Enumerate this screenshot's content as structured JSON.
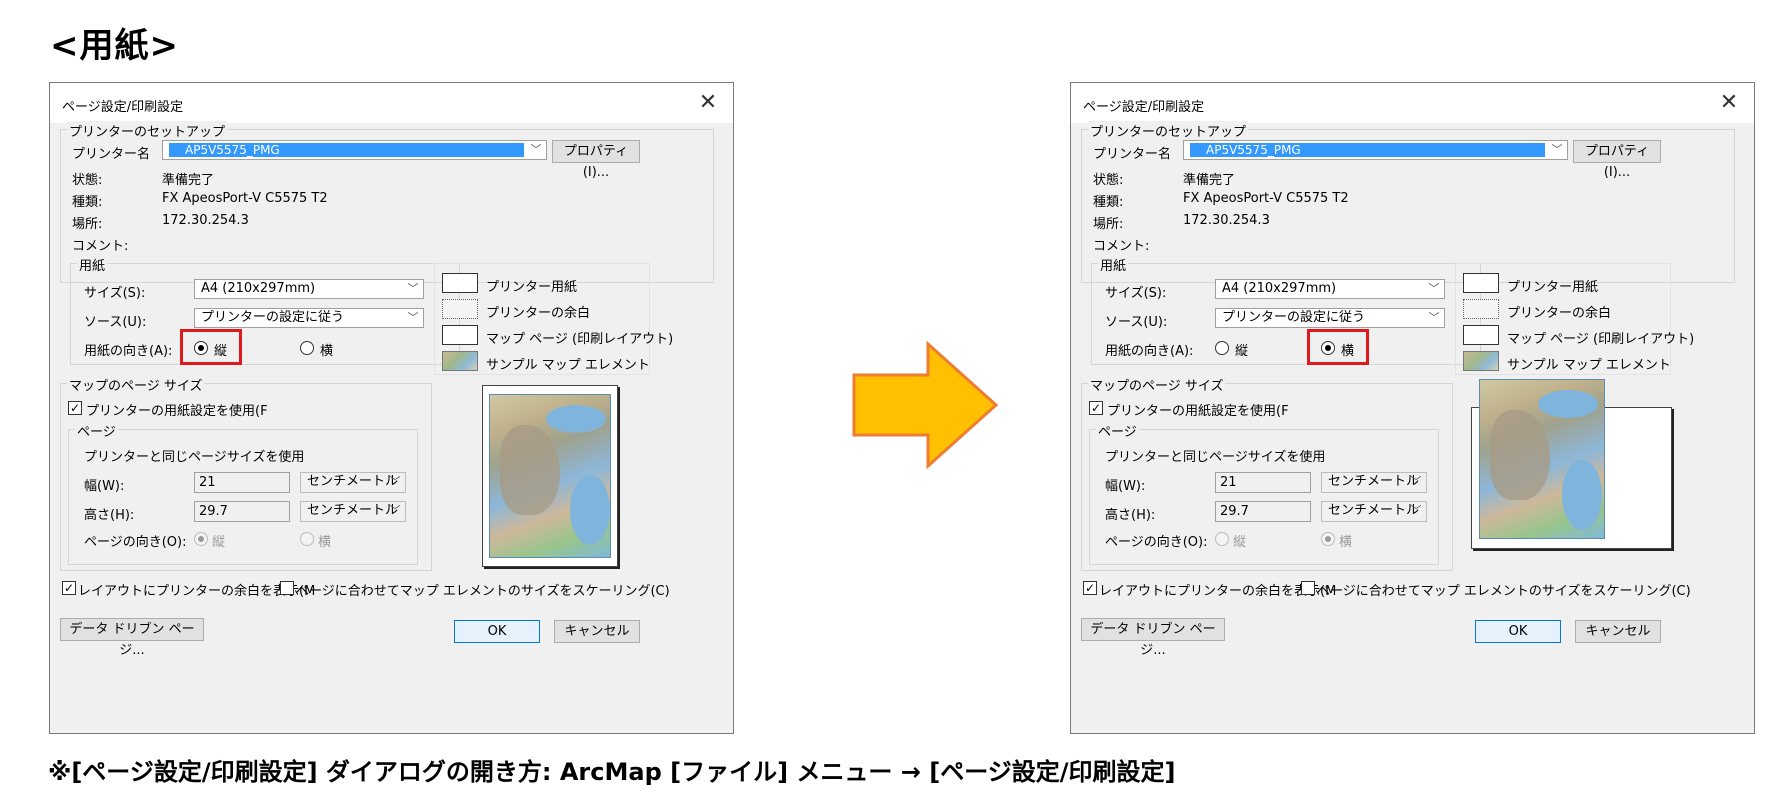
{
  "page": {
    "title": "<用紙>",
    "footnote": "※[ページ設定/印刷設定] ダイアログの開き方: ArcMap [ファイル] メニュー → [ページ設定/印刷設定]"
  },
  "dialog": {
    "title": "ページ設定/印刷設定",
    "close": "✕",
    "printer_setup": {
      "group_label": "プリンターのセットアップ",
      "printer_name_label": "プリンター名",
      "printer_name_value": "AP5V5575_PMG",
      "properties_button": "プロパティ(I)...",
      "status_label": "状態:",
      "status_value": "準備完了",
      "type_label": "種類:",
      "type_value": "FX ApeosPort-V C5575 T2",
      "location_label": "場所:",
      "location_value": "172.30.254.3",
      "comment_label": "コメント:"
    },
    "paper": {
      "group_label": "用紙",
      "size_label": "サイズ(S):",
      "size_value": "A4 (210x297mm)",
      "source_label": "ソース(U):",
      "source_value": "プリンターの設定に従う",
      "orientation_label": "用紙の向き(A):",
      "portrait_label": "縦",
      "landscape_label": "横"
    },
    "legend": {
      "printer_paper": "プリンター用紙",
      "printer_margin": "プリンターの余白",
      "map_page": "マップ ページ (印刷レイアウト)",
      "sample_map_element": "サンプル マップ エレメント"
    },
    "map_page_size": {
      "group_label": "マップのページ サイズ",
      "use_printer_paper_label": "プリンターの用紙設定を使用(F",
      "page_group_label": "ページ",
      "same_as_printer_label": "プリンターと同じページサイズを使用",
      "width_label": "幅(W):",
      "width_value": "21",
      "height_label": "高さ(H):",
      "height_value": "29.7",
      "unit_value": "センチメートル",
      "page_orientation_label": "ページの向き(O):",
      "portrait_label": "縦",
      "landscape_label": "横"
    },
    "show_margins_label": "レイアウトにプリンターの余白を表示(M",
    "scale_elements_label": "ページに合わせてマップ エレメントのサイズをスケーリング(C)",
    "data_driven_button": "データ ドリブン ページ...",
    "ok_button": "OK",
    "cancel_button": "キャンセル"
  },
  "state": {
    "left_dialog_orientation": "portrait",
    "right_dialog_orientation": "landscape",
    "use_printer_paper_checked": true,
    "show_margins_checked": true,
    "scale_elements_checked": false
  },
  "colors": {
    "highlight": "#e0191c",
    "arrow_fill": "#ffc000",
    "arrow_stroke": "#ed7d31",
    "selection": "#3399ff"
  },
  "icons": [
    "printer-icon",
    "close-icon",
    "chevron-down-icon",
    "arrow-right-icon"
  ]
}
